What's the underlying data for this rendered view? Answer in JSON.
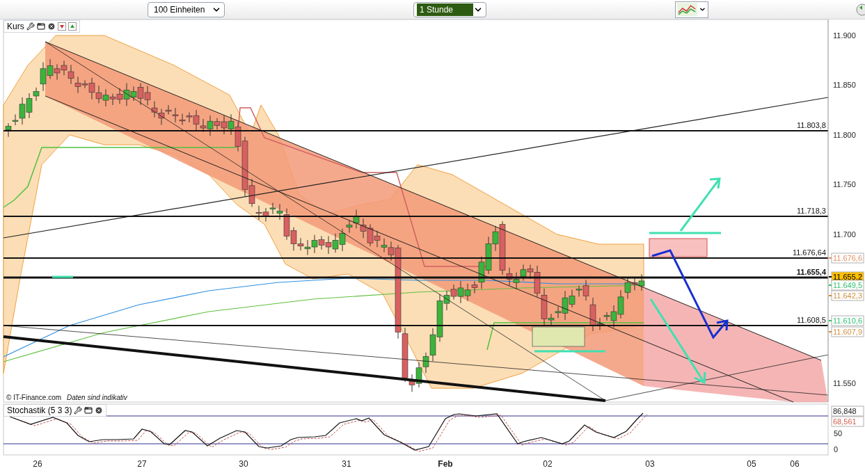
{
  "toolbar": {
    "quantity_select": "100 Einheiten",
    "interval_select": "1 Stunde"
  },
  "price_panel": {
    "title": "Kurs",
    "y_ticks": [
      "11.900",
      "11.850",
      "11.800",
      "11.750",
      "11.700",
      "11.550"
    ],
    "level_lines": [
      {
        "label": "11.803,8",
        "bold": false
      },
      {
        "label": "11.718,3",
        "bold": false
      },
      {
        "label": "11.676,64",
        "bold": false
      },
      {
        "label": "11.655,4",
        "bold": true
      },
      {
        "label": "11.608,5",
        "bold": false
      }
    ],
    "price_tags": [
      {
        "text": "11.676,6",
        "color": "#e09060",
        "highlighted": false
      },
      {
        "text": "11.655,2",
        "color": "#000000",
        "highlighted": true
      },
      {
        "text": "11.649,5",
        "color": "#30c070",
        "highlighted": false
      },
      {
        "text": "11.642,3",
        "color": "#d09040",
        "highlighted": false
      },
      {
        "text": "11.610,6",
        "color": "#30c070",
        "highlighted": false
      },
      {
        "text": "11.607,9",
        "color": "#d09040",
        "highlighted": false
      }
    ],
    "copyright": "© IT-Finance.com",
    "disclaimer": "Daten sind indikativ"
  },
  "stochastic_panel": {
    "title": "Stochastik (5 3 3)",
    "y_ticks": [
      "50",
      "0"
    ],
    "tags": [
      {
        "text": "86,848",
        "color": "#202020"
      },
      {
        "text": "68,561",
        "color": "#d06050"
      }
    ]
  },
  "x_axis": [
    {
      "label": "26",
      "bold": false
    },
    {
      "label": "27",
      "bold": false
    },
    {
      "label": "30",
      "bold": false
    },
    {
      "label": "31",
      "bold": false
    },
    {
      "label": "Feb",
      "bold": true
    },
    {
      "label": "02",
      "bold": false
    },
    {
      "label": "03",
      "bold": false
    },
    {
      "label": "05",
      "bold": false
    },
    {
      "label": "06",
      "bold": false
    }
  ]
}
